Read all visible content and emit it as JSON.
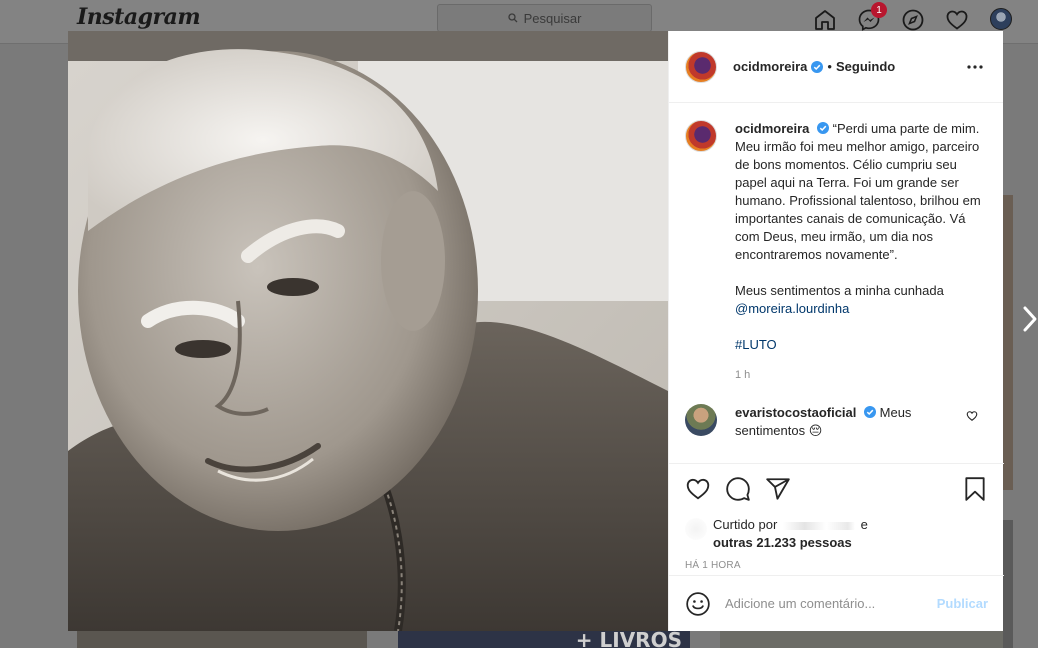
{
  "app": {
    "logo": "Instagram",
    "search_placeholder": "Pesquisar",
    "dm_badge": "1"
  },
  "bg": {
    "tile_text": "+ LIVROS"
  },
  "post": {
    "username": "ocidmoreira",
    "dot": "•",
    "following": "Seguindo",
    "caption": {
      "username": "ocidmoreira",
      "text": "“Perdi uma parte de mim. Meu irmão foi meu melhor amigo, parceiro de bons momentos. Célio cumpriu seu papel aqui na Terra. Foi um grande ser humano. Profissional talentoso, brilhou em importantes canais de comunicação. Vá com Deus, meu irmão, um dia nos encontraremos novamente”.",
      "para2": "Meus sentimentos a minha cunhada",
      "mention": "@moreira.lourdinha",
      "hashtag": "#LUTO",
      "time": "1 h"
    },
    "comment": {
      "username": "evaristocostaoficial",
      "text": "Meus sentimentos 😔"
    },
    "likes": {
      "prefix": "Curtido por",
      "conj": "e",
      "others": "outras 21.233 pessoas"
    },
    "posted_ago": "HÁ 1 HORA",
    "add_comment": {
      "placeholder": "Adicione um comentário...",
      "publish": "Publicar"
    }
  },
  "icons": [
    "search-icon",
    "home-icon",
    "messenger-icon",
    "explore-icon",
    "heart-icon",
    "more-icon",
    "verified-icon",
    "like-icon",
    "comment-icon",
    "share-icon",
    "bookmark-icon",
    "emoji-icon",
    "chevron-right-icon"
  ],
  "colors": {
    "verified": "#3897f0",
    "link": "#00376b",
    "publish": "#b3dbff",
    "badge": "#ed4956"
  }
}
